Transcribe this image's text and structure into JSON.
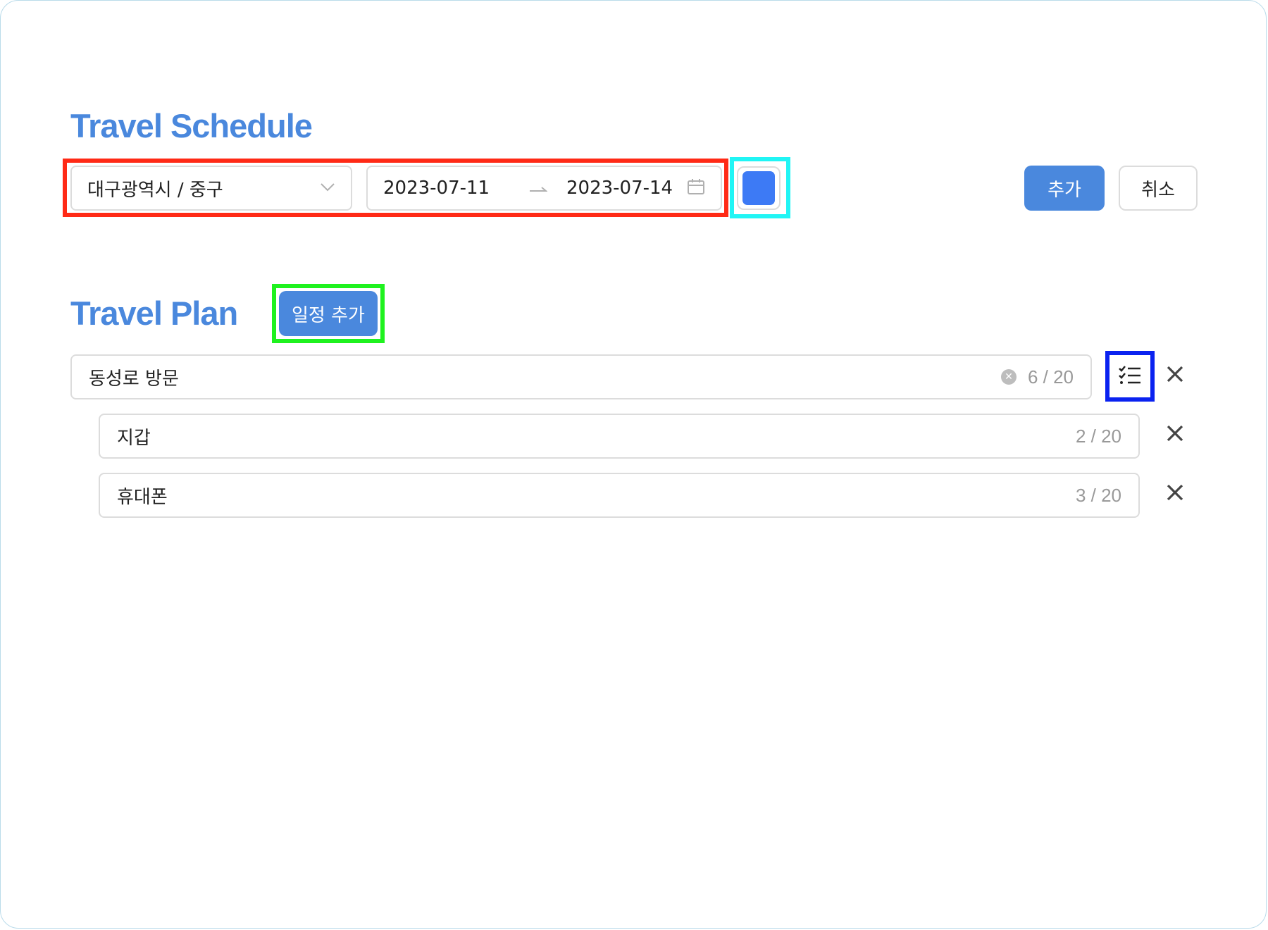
{
  "schedule": {
    "title": "Travel Schedule",
    "region": "대구광역시 / 중구",
    "date_start": "2023-07-11",
    "date_end": "2023-07-14",
    "color": "#3d7af5",
    "add_label": "추가",
    "cancel_label": "취소"
  },
  "plan": {
    "title": "Travel Plan",
    "add_plan_label": "일정 추가",
    "main": {
      "value": "동성로 방문",
      "count": "6 / 20"
    },
    "items": [
      {
        "value": "지갑",
        "count": "2 / 20"
      },
      {
        "value": "휴대폰",
        "count": "3 / 20"
      }
    ]
  },
  "colors": {
    "accent": "#4a88dd",
    "highlight_red": "#ff2a16",
    "highlight_cyan": "#20f5f5",
    "highlight_green": "#1ff21f",
    "highlight_blue": "#0a22f0"
  }
}
